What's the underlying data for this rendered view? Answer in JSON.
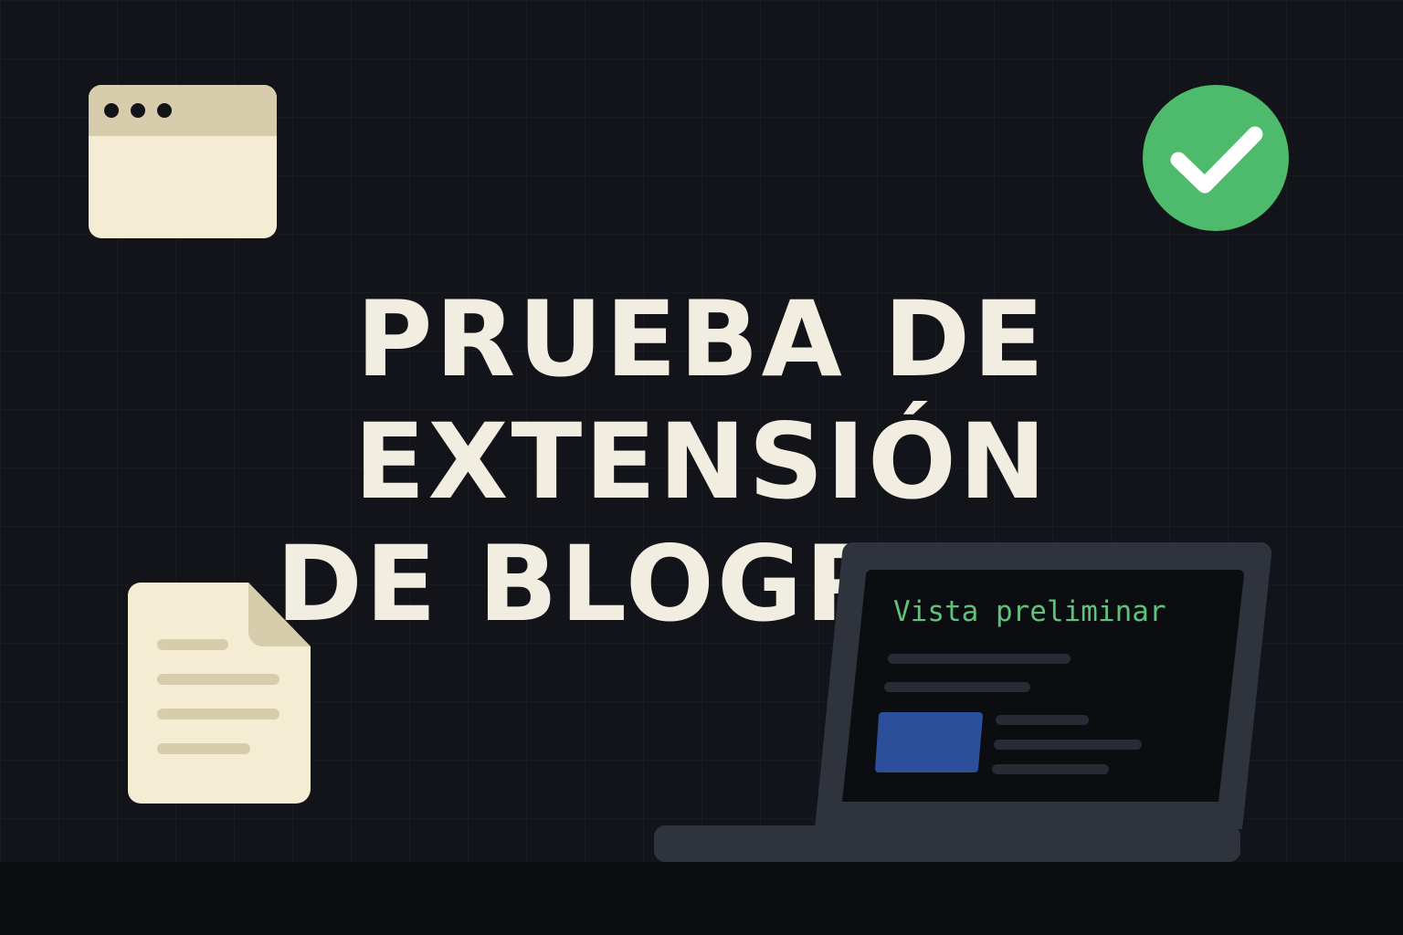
{
  "hero": {
    "title_line1": "PRUEBA DE EXTENSIÓN",
    "title_line2": "DE BLOGPOST"
  },
  "laptop": {
    "screen_label": "Vista preliminar"
  },
  "icons": {
    "browser": "browser-window-icon",
    "success": "checkmark-circle-icon",
    "document": "document-icon",
    "laptop": "laptop-icon"
  },
  "colors": {
    "background": "#121419",
    "title_text": "#f1ede0",
    "cream": "#f4edd4",
    "tan": "#d7ccab",
    "success_green": "#4dbb6b",
    "preview_green": "#5fc27a",
    "image_blue": "#2b4f9a",
    "laptop_frame": "#2f333b"
  }
}
